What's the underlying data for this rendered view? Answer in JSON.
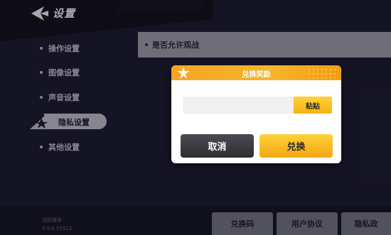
{
  "header": {
    "title": "设置",
    "back_icon": "back-arrow-icon"
  },
  "sidebar": {
    "items": [
      {
        "label": "操作设置",
        "active": false
      },
      {
        "label": "图像设置",
        "active": false
      },
      {
        "label": "声音设置",
        "active": false
      },
      {
        "label": "隐私设置",
        "active": true
      },
      {
        "label": "其他设置",
        "active": false
      }
    ]
  },
  "content": {
    "row_label": "是否允许观战"
  },
  "dialog": {
    "title": "兑换奖励",
    "input_value": "",
    "input_placeholder": "",
    "paste_label": "粘贴",
    "cancel_label": "取消",
    "confirm_label": "兑换"
  },
  "footer": {
    "version_label": "当前版本:",
    "version_value": "0.9.6.55512",
    "buttons": [
      "兑换码",
      "用户协议",
      "隐私政"
    ]
  },
  "colors": {
    "background": "#1d1b2e",
    "accent": "#f5a623",
    "active_item": "#c9c9d4"
  }
}
